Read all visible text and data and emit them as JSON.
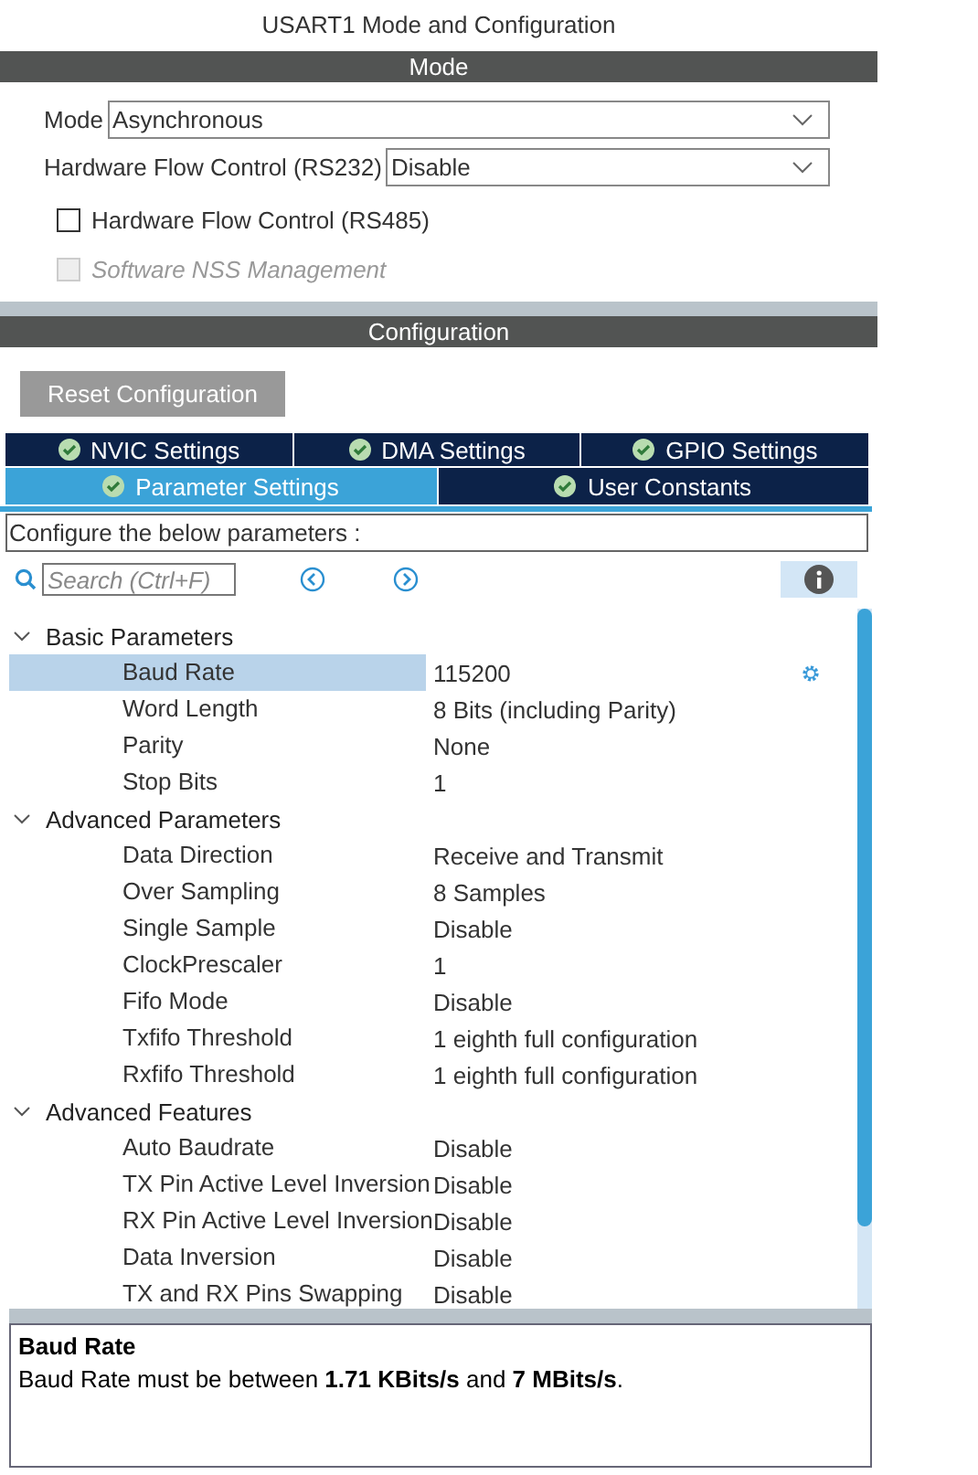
{
  "title": "USART1 Mode and Configuration",
  "mode_section": {
    "header": "Mode",
    "fields": [
      {
        "label": "Mode",
        "value": "Asynchronous"
      },
      {
        "label": "Hardware Flow Control (RS232)",
        "value": "Disable"
      }
    ],
    "checkboxes": [
      {
        "label": "Hardware Flow Control (RS485)",
        "checked": false,
        "disabled": false
      },
      {
        "label": "Software NSS Management",
        "checked": false,
        "disabled": true
      }
    ]
  },
  "config_section": {
    "header": "Configuration",
    "reset_button": "Reset Configuration",
    "tab_rows": [
      [
        {
          "label": "NVIC Settings",
          "selected": false
        },
        {
          "label": "DMA Settings",
          "selected": false
        },
        {
          "label": "GPIO Settings",
          "selected": false
        }
      ],
      [
        {
          "label": "Parameter Settings",
          "selected": true
        },
        {
          "label": "User Constants",
          "selected": false
        }
      ]
    ],
    "instructions": "Configure the below parameters :",
    "search": {
      "placeholder": "Search (Ctrl+F)"
    },
    "groups": [
      {
        "label": "Basic Parameters",
        "expanded": true,
        "children": [
          {
            "name": "Baud Rate",
            "value": "115200",
            "selected": true
          },
          {
            "name": "Word Length",
            "value": "8 Bits (including Parity)",
            "selected": false
          },
          {
            "name": "Parity",
            "value": "None",
            "selected": false
          },
          {
            "name": "Stop Bits",
            "value": "1",
            "selected": false
          }
        ]
      },
      {
        "label": "Advanced Parameters",
        "expanded": true,
        "children": [
          {
            "name": "Data Direction",
            "value": "Receive and Transmit",
            "selected": false
          },
          {
            "name": "Over Sampling",
            "value": "8 Samples",
            "selected": false
          },
          {
            "name": "Single Sample",
            "value": "Disable",
            "selected": false
          },
          {
            "name": "ClockPrescaler",
            "value": "1",
            "selected": false
          },
          {
            "name": "Fifo Mode",
            "value": "Disable",
            "selected": false
          },
          {
            "name": "Txfifo Threshold",
            "value": "1 eighth full configuration",
            "selected": false
          },
          {
            "name": "Rxfifo Threshold",
            "value": "1 eighth full configuration",
            "selected": false
          }
        ]
      },
      {
        "label": "Advanced Features",
        "expanded": true,
        "children": [
          {
            "name": "Auto Baudrate",
            "value": "Disable",
            "selected": false
          },
          {
            "name": "TX Pin Active Level Inversion",
            "value": "Disable",
            "selected": false
          },
          {
            "name": "RX Pin Active Level Inversion",
            "value": "Disable",
            "selected": false
          },
          {
            "name": "Data Inversion",
            "value": "Disable",
            "selected": false
          },
          {
            "name": "TX and RX Pins Swapping",
            "value": "Disable",
            "selected": false
          }
        ]
      }
    ],
    "description": {
      "title": "Baud Rate",
      "text": "Baud Rate must be between **1.71 KBits/s** and **7 MBits/s**."
    }
  }
}
